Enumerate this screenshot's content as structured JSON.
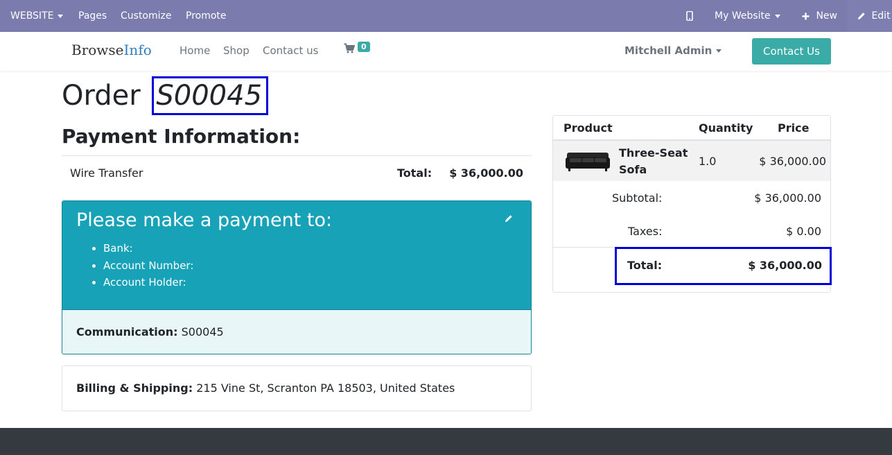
{
  "admin_bar": {
    "website_menu": "WEBSITE",
    "pages": "Pages",
    "customize": "Customize",
    "promote": "Promote",
    "site_selector": "My Website",
    "new": "New",
    "edit": "Edit",
    "bg_color": "#7c7bad"
  },
  "header": {
    "logo_part1": "Browse",
    "logo_part2": "Info",
    "nav": [
      "Home",
      "Shop",
      "Contact us"
    ],
    "cart_count": "0",
    "user": "Mitchell Admin",
    "contact_button": "Contact Us",
    "accent_color": "#3aaba6"
  },
  "order": {
    "title_prefix": "Order",
    "number": "S00045"
  },
  "payment": {
    "heading": "Payment Information:",
    "method": "Wire Transfer",
    "total_label": "Total:",
    "total_value": "$ 36,000.00"
  },
  "instructions": {
    "title": "Please make a payment to:",
    "items": [
      "Bank:",
      "Account Number:",
      "Account Holder:"
    ],
    "communication_label": "Communication:",
    "communication_value": "S00045"
  },
  "billing": {
    "label": "Billing & Shipping:",
    "address": "215 Vine St, Scranton PA 18503, United States"
  },
  "summary": {
    "columns": [
      "Product",
      "Quantity",
      "Price"
    ],
    "product": {
      "name": "Three-Seat Sofa",
      "quantity": "1.0",
      "price": "$ 36,000.00"
    },
    "subtotal_label": "Subtotal:",
    "subtotal_value": "$ 36,000.00",
    "taxes_label": "Taxes:",
    "taxes_value": "$ 0.00",
    "total_label": "Total:",
    "total_value": "$ 36,000.00"
  }
}
